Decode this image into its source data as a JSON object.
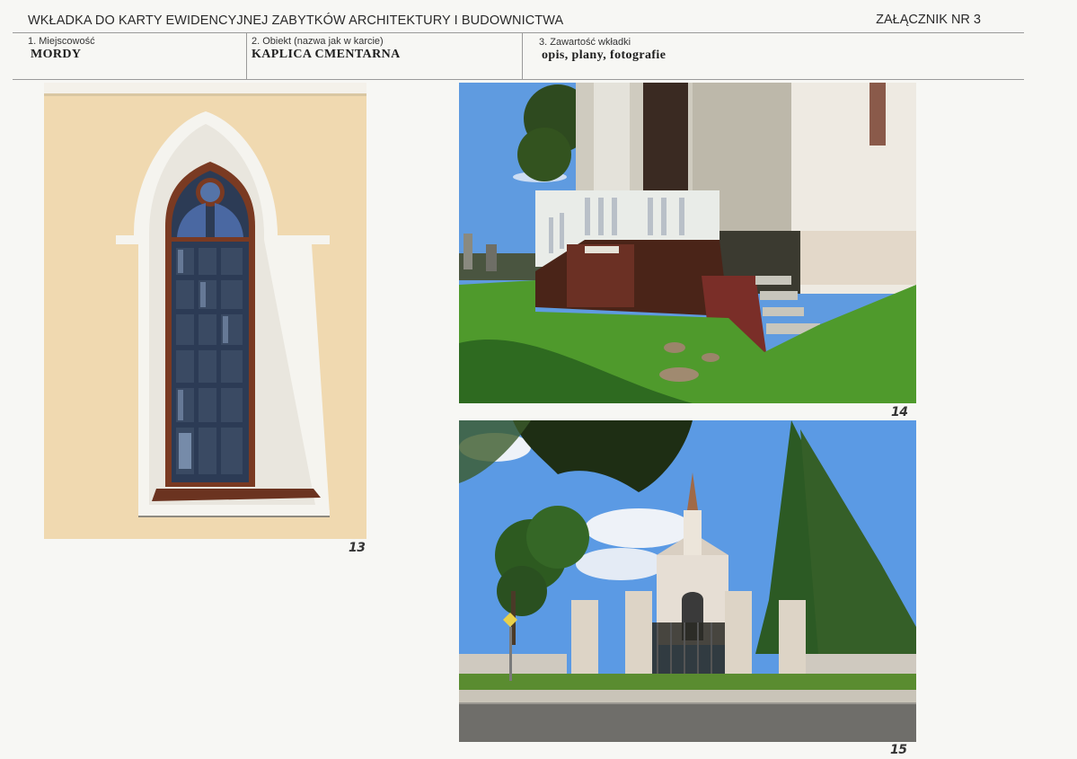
{
  "header": {
    "title": "WKŁADKA DO KARTY EWIDENCYJNEJ ZABYTKÓW ARCHITEKTURY I BUDOWNICTWA",
    "annex": "ZAŁĄCZNIK NR 3"
  },
  "fields": {
    "locality_label": "1. Miejscowość",
    "locality_value": "MORDY",
    "object_label": "2. Obiekt (nazwa jak w karcie)",
    "object_value": "KAPLICA CMENTARNA",
    "contents_label": "3. Zawartość wkładki",
    "contents_value": "opis, plany, fotografie"
  },
  "photos": [
    {
      "number": "13",
      "subject": "window"
    },
    {
      "number": "14",
      "subject": "entrance-stairs"
    },
    {
      "number": "15",
      "subject": "chapel-gate"
    }
  ],
  "colors": {
    "wall": "#f0d9b0",
    "frame_brown": "#7a3a22",
    "sky": "#5f9be0",
    "grass": "#4f9a2c"
  }
}
